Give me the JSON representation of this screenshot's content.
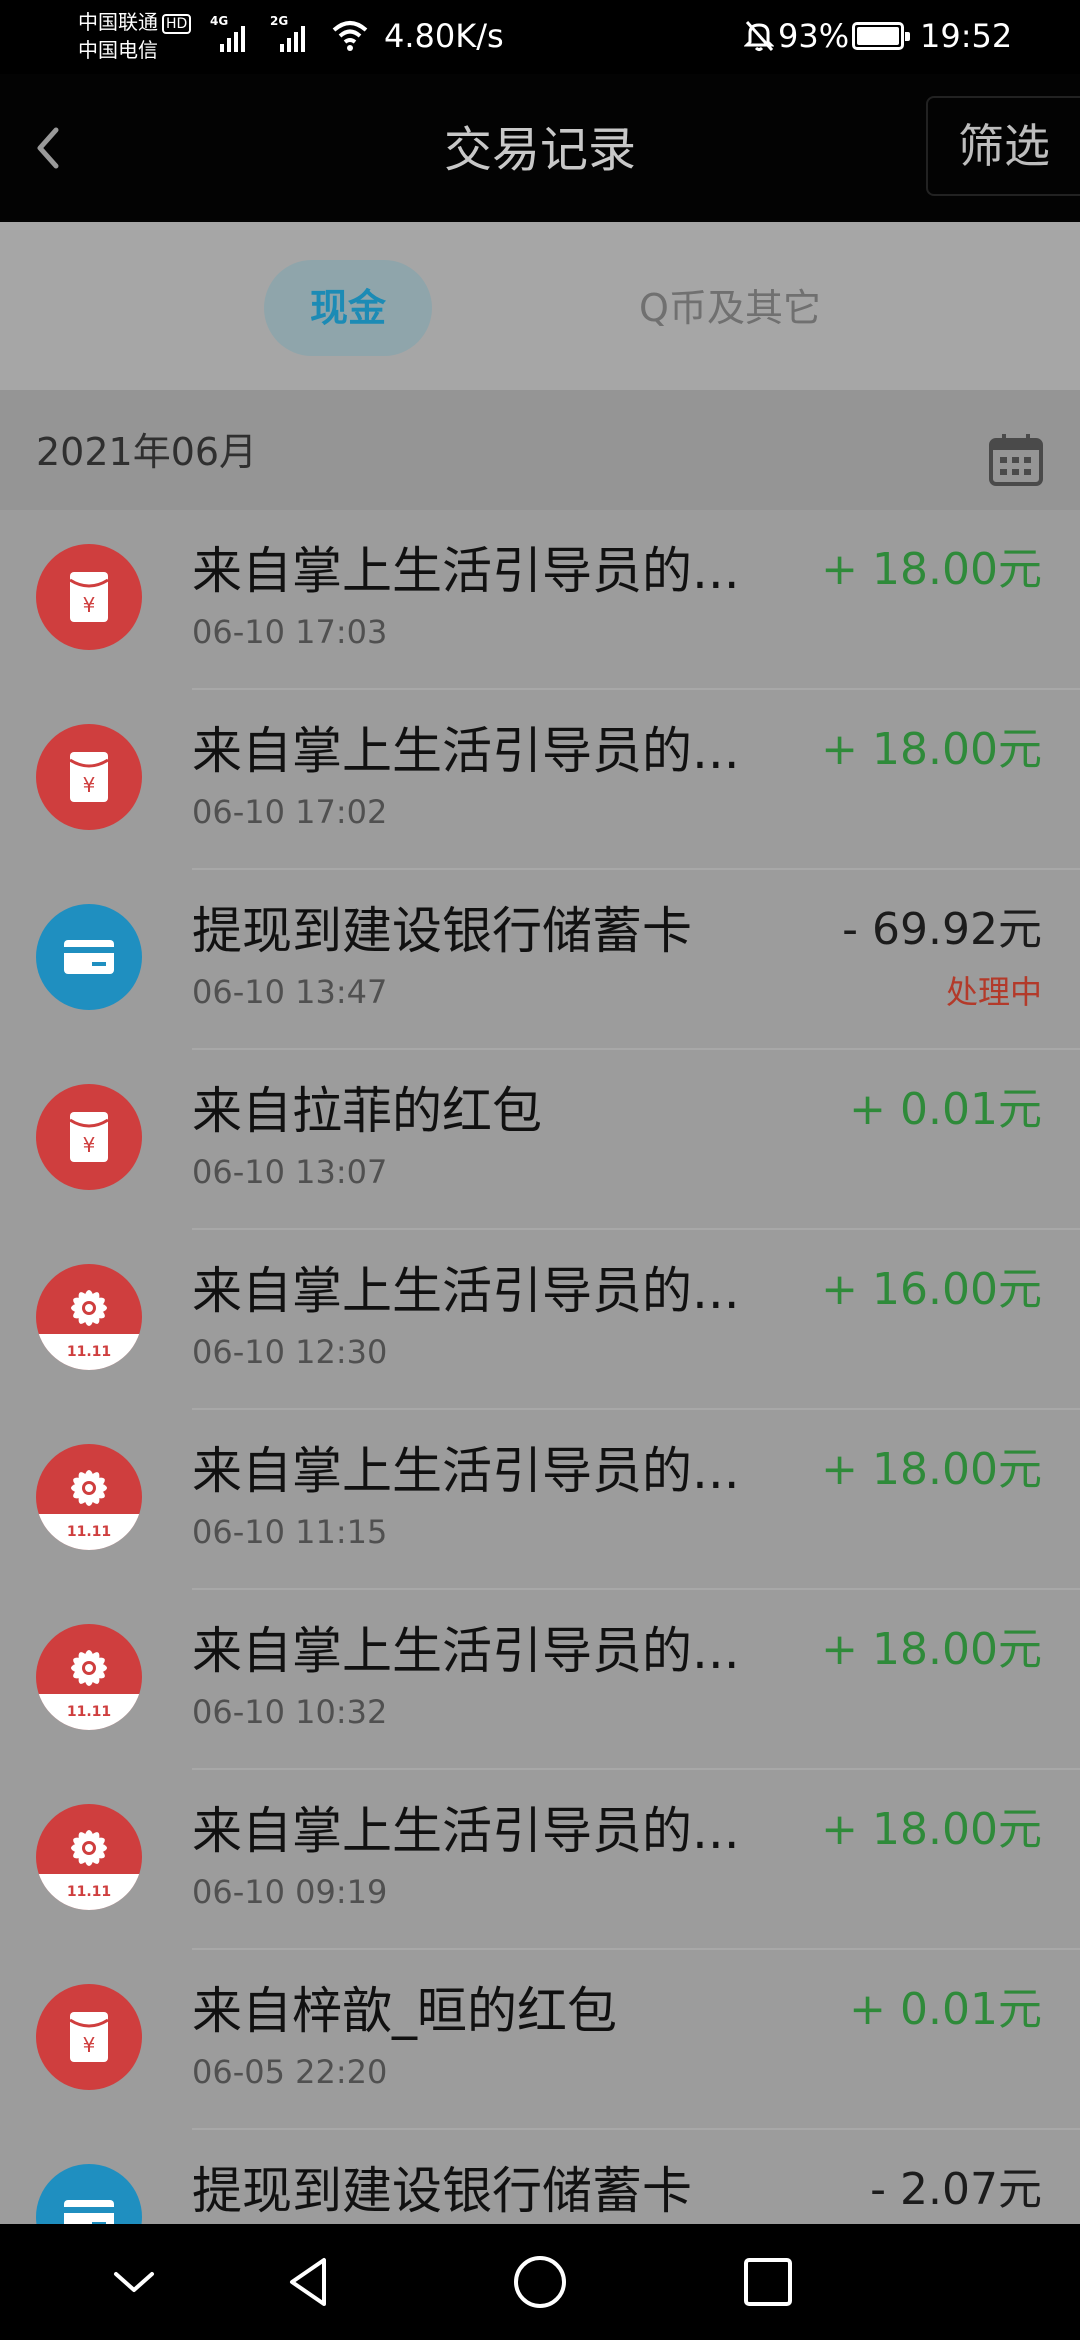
{
  "status_bar": {
    "carrier1": "中国联通",
    "carrier1_badge": "HD",
    "carrier2": "中国电信",
    "sim1_label": "4G",
    "sim2_label": "2G",
    "speed": "4.80K/s",
    "battery": "93%",
    "time": "19:52"
  },
  "header": {
    "title": "交易记录",
    "filter_label": "筛选"
  },
  "tabs": [
    {
      "label": "现金",
      "active": true
    },
    {
      "label": "Q币及其它",
      "active": false
    }
  ],
  "month": {
    "label": "2021年06月"
  },
  "transactions": [
    {
      "name": "来自掌上生活引导员的...",
      "time": "06-10 17:03",
      "amount": "+ 18.00元",
      "icon": "red-packet-icon",
      "status": ""
    },
    {
      "name": "来自掌上生活引导员的...",
      "time": "06-10 17:02",
      "amount": "+ 18.00元",
      "icon": "red-packet-icon",
      "status": ""
    },
    {
      "name": "提现到建设银行储蓄卡",
      "time": "06-10 13:47",
      "amount": "- 69.92元",
      "icon": "bank-card-icon",
      "status": "处理中"
    },
    {
      "name": "来自拉菲的红包",
      "time": "06-10 13:07",
      "amount": "+ 0.01元",
      "icon": "red-packet-icon",
      "status": ""
    },
    {
      "name": "来自掌上生活引导员的...",
      "time": "06-10 12:30",
      "amount": "+ 16.00元",
      "icon": "flower-11-11-icon",
      "icon_text": "11.11",
      "status": ""
    },
    {
      "name": "来自掌上生活引导员的...",
      "time": "06-10 11:15",
      "amount": "+ 18.00元",
      "icon": "flower-11-11-icon",
      "icon_text": "11.11",
      "status": ""
    },
    {
      "name": "来自掌上生活引导员的...",
      "time": "06-10 10:32",
      "amount": "+ 18.00元",
      "icon": "flower-11-11-icon",
      "icon_text": "11.11",
      "status": ""
    },
    {
      "name": "来自掌上生活引导员的...",
      "time": "06-10 09:19",
      "amount": "+ 18.00元",
      "icon": "flower-11-11-icon",
      "icon_text": "11.11",
      "status": ""
    },
    {
      "name": "来自梓歆_晅的红包",
      "time": "06-05 22:20",
      "amount": "+ 0.01元",
      "icon": "red-packet-icon",
      "status": ""
    },
    {
      "name": "提现到建设银行储蓄卡",
      "time": "",
      "amount": "- 2.07元",
      "icon": "bank-card-icon",
      "status": ""
    }
  ],
  "colors": {
    "income": "#2f8a3a",
    "expense": "#1c1c1c",
    "processing": "#b33a2a",
    "tab_active": "#1c8bb5",
    "red_icon": "#cf3e3e",
    "blue_icon": "#1f8fc0"
  },
  "icons": {
    "back": "back-arrow-icon",
    "calendar": "calendar-icon",
    "nav": [
      "collapse-icon",
      "back-triangle-icon",
      "home-circle-icon",
      "recents-square-icon"
    ]
  }
}
